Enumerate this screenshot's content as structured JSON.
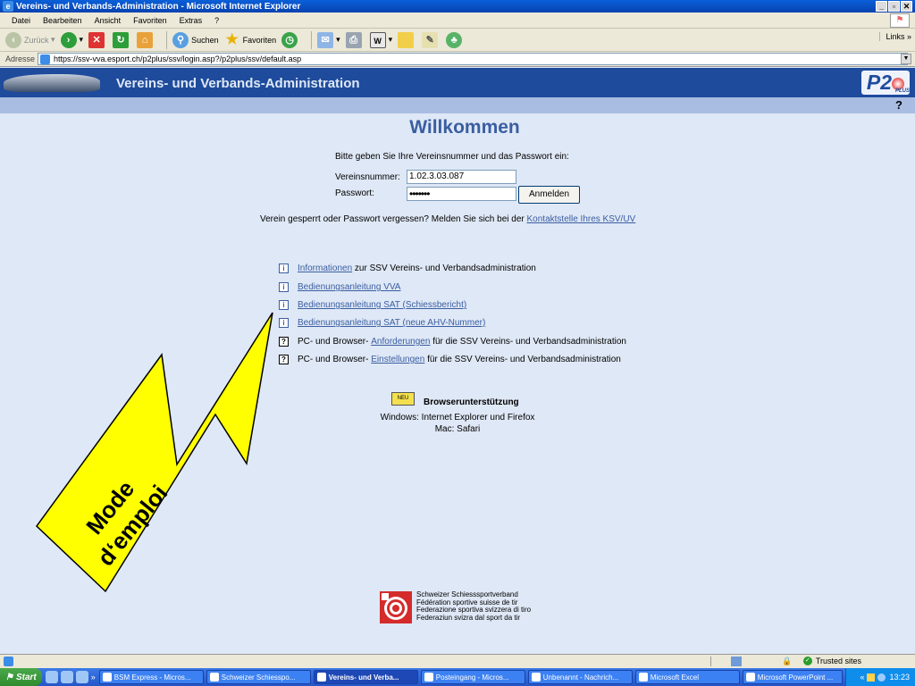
{
  "window": {
    "title": "Vereins- und Verbands-Administration - Microsoft Internet Explorer"
  },
  "menu": [
    "Datei",
    "Bearbeiten",
    "Ansicht",
    "Favoriten",
    "Extras",
    "?"
  ],
  "toolbar": {
    "back": "Zurück",
    "search": "Suchen",
    "favorites": "Favoriten",
    "links": "Links"
  },
  "address": {
    "label": "Adresse",
    "url": "https://ssv-vva.esport.ch/p2plus/ssv/login.asp?/p2plus/ssv/default.asp"
  },
  "banner": {
    "title": "Vereins- und Verbands-Administration",
    "logo": "P2",
    "logo_sub": "PLUS",
    "help": "?"
  },
  "login": {
    "welcome": "Willkommen",
    "prompt": "Bitte geben Sie Ihre Vereinsnummer und das Passwort ein:",
    "club_label": "Vereinsnummer:",
    "club_value": "1.02.3.03.087",
    "password_label": "Passwort:",
    "password_value": "•••••••",
    "submit": "Anmelden",
    "help_text": "Verein gesperrt oder Passwort vergessen? Melden Sie sich bei der",
    "help_link": "Kontaktstelle Ihres KSV/UV"
  },
  "links": [
    {
      "icon": "i",
      "link": "Informationen",
      "after": " zur SSV Vereins- und Verbandsadministration",
      "before": ""
    },
    {
      "icon": "i",
      "link": "Bedienungsanleitung VVA",
      "after": "",
      "before": ""
    },
    {
      "icon": "i",
      "link": "Bedienungsanleitung SAT (Schiessbericht)",
      "after": "",
      "before": ""
    },
    {
      "icon": "i",
      "link": "Bedienungsanleitung SAT (neue AHV-Nummer)",
      "after": "",
      "before": ""
    },
    {
      "icon": "?",
      "before": "PC- und Browser- ",
      "link": "Anforderungen",
      "after": " für die SSV Vereins- und Verbandsadministration"
    },
    {
      "icon": "?",
      "before": "PC- und Browser- ",
      "link": "Einstellungen",
      "after": " für die SSV Vereins- und Verbandsadministration"
    }
  ],
  "browser_support": {
    "badge": "NEU",
    "title": "Browserunterstützung",
    "windows": "Windows: Internet Explorer und Firefox",
    "mac": "Mac: Safari"
  },
  "footer": {
    "lines": [
      "Schweizer Schiesssportverband",
      "Fédération sportive suisse de tir",
      "Federazione sportiva svizzera di tiro",
      "Federaziun svizra dal sport da tir"
    ]
  },
  "annotation": {
    "line1": "Mode",
    "line2": "d‘emploi",
    "color": "#ffff00"
  },
  "status": {
    "zone": "Trusted sites"
  },
  "taskbar": {
    "start": "Start",
    "tasks": [
      "BSM Express - Micros...",
      "Schweizer Schiesspo...",
      "Vereins- und Verba...",
      "Posteingang - Micros...",
      "Unbenannt - Nachrich...",
      "Microsoft Excel",
      "Microsoft PowerPoint ..."
    ],
    "active_index": 2,
    "clock": "13:23"
  }
}
